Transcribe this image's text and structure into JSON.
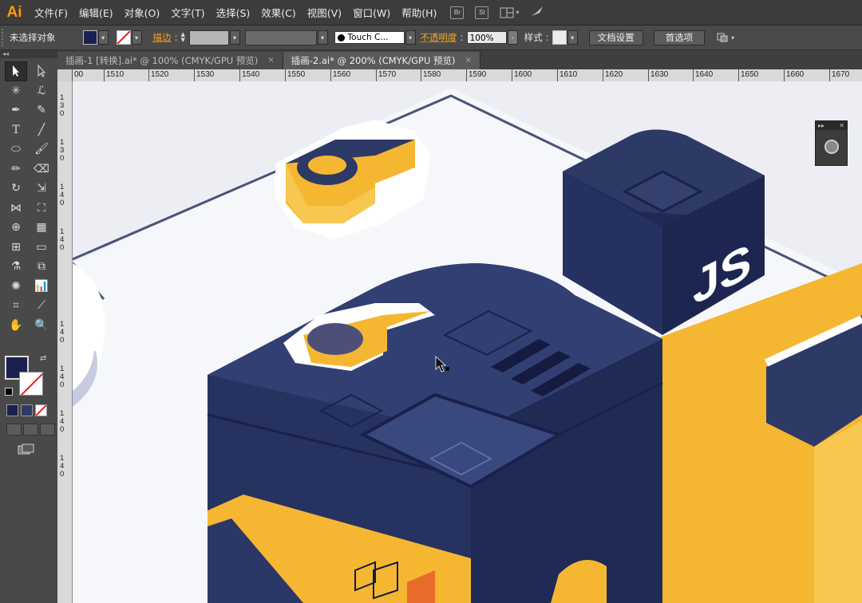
{
  "app": {
    "logo": "Ai"
  },
  "menu": [
    "文件(F)",
    "编辑(E)",
    "对象(O)",
    "文字(T)",
    "选择(S)",
    "效果(C)",
    "视图(V)",
    "窗口(W)",
    "帮助(H)"
  ],
  "menu_icons": [
    {
      "name": "bridge-icon",
      "glyph": "Br"
    },
    {
      "name": "stock-icon",
      "glyph": "St"
    }
  ],
  "control": {
    "selection": "未选择对象",
    "stroke_label": "描边",
    "brush": "Touch C...",
    "opacity_label": "不透明度",
    "opacity_value": "100%",
    "style_label": "样式",
    "doc_settings": "文档设置",
    "preferences": "首选项"
  },
  "tabs": [
    {
      "label": "插画-1 [转换].ai* @ 100% (CMYK/GPU 预览)",
      "close": "×",
      "active": false
    },
    {
      "label": "插画-2.ai* @ 200% (CMYK/GPU 预览)",
      "close": "×",
      "active": true
    }
  ],
  "ruler": {
    "top": [
      "00",
      "1510",
      "1520",
      "1530",
      "1540",
      "1550",
      "1560",
      "1570",
      "1580",
      "1590",
      "1600",
      "1610",
      "1620",
      "1630",
      "1640",
      "1650",
      "1660",
      "1670"
    ],
    "left": [
      "1\n3\n0",
      "1\n3\n0",
      "1\n4\n0",
      "1\n4\n0",
      "1\n4\n0",
      "1\n4\n0",
      "1\n4\n0",
      "1\n4\n0"
    ]
  },
  "canvas_text": {
    "js_label": "JS"
  },
  "colors": {
    "accent_orange": "#f5a623",
    "navy": "#2d3a66",
    "navy_dark": "#1f2a52",
    "yellow": "#f8b735"
  }
}
